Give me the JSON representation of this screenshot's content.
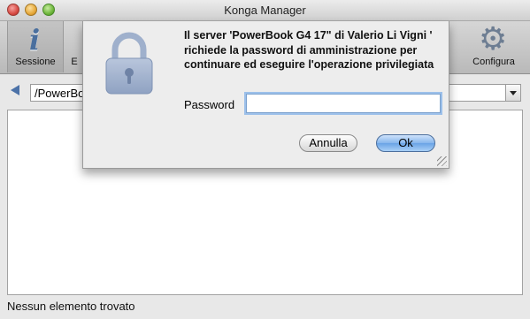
{
  "window": {
    "title": "Konga Manager"
  },
  "toolbar": {
    "sessione_label": "Sessione",
    "e_label": "E",
    "configura_label": "Configura"
  },
  "path": {
    "value": "/PowerBook G4 17\" di Valerio Li Vigni"
  },
  "status": {
    "text": "Nessun elemento trovato"
  },
  "dialog": {
    "message": "Il server 'PowerBook G4 17\" di Valerio Li Vigni ' richiede la password di amministrazione per continuare ed eseguire l'operazione privilegiata",
    "password_label": "Password",
    "password_value": "",
    "cancel_label": "Annulla",
    "ok_label": "Ok"
  },
  "icons": {
    "info": "info-icon",
    "gear": "gear-icon",
    "lock": "lock-icon",
    "back": "back-arrow-icon",
    "dropdown": "chevron-down-icon"
  },
  "colors": {
    "accent": "#6aa3e6",
    "info_icon": "#4a6f9e"
  }
}
